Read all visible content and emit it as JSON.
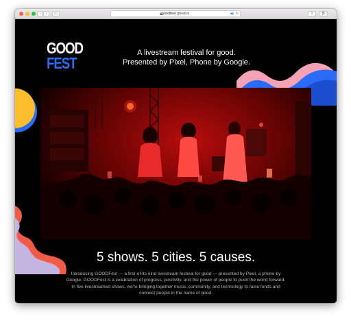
{
  "browser": {
    "url": "goodfest.good.is",
    "colors": {
      "close": "#fd5e57",
      "minimize": "#fdbc2e",
      "zoom": "#28c840"
    }
  },
  "page": {
    "logo": {
      "line1": "GOOD",
      "line2": "FEST"
    },
    "tagline": {
      "line1": "A livestream festival for good.",
      "line2": "Presented by Pixel, Phone by Google."
    },
    "hero_image": {
      "description_icon": "concert-stage-photo"
    },
    "headline": "5 shows. 5 cities. 5 causes.",
    "body": "Introducing GOODFest — a first-of-its-kind livestream festival for good — presented by Pixel, a phone by Google. GOODFest is a celebration of progress, positivity, and the power of people to push the world forward. In five livestreamed shows, we're bringing together music, community, and technology to raise funds and connect people in the name of good.",
    "colors": {
      "background": "#000000",
      "brand_blue": "#2a6cf6",
      "wave_pink": "#f5a3b4",
      "wave_orange": "#f25b45",
      "circle_yellow": "#fbbd2c",
      "blob_lavender": "#c3b4e0"
    }
  }
}
